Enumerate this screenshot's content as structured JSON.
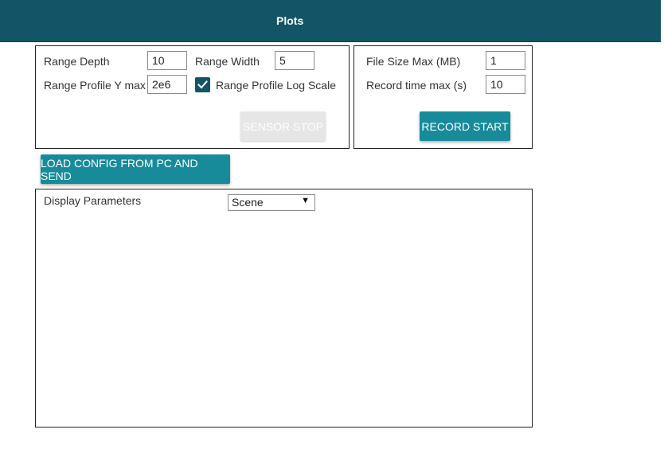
{
  "header": {
    "title": "Plots"
  },
  "sensor_panel": {
    "range_depth_label": "Range Depth",
    "range_depth_value": "10",
    "range_width_label": "Range Width",
    "range_width_value": "5",
    "range_profile_ymax_label": "Range Profile Y max",
    "range_profile_ymax_value": "2e6",
    "log_scale_label": "Range Profile Log Scale",
    "log_scale_checked": true,
    "sensor_stop_label": "SENSOR STOP"
  },
  "record_panel": {
    "file_size_label": "File Size Max (MB)",
    "file_size_value": "1",
    "record_time_label": "Record time max (s)",
    "record_time_value": "10",
    "record_start_label": "RECORD START"
  },
  "load_config_label": "LOAD CONFIG FROM PC AND SEND",
  "display_panel": {
    "label": "Display Parameters",
    "selected": "Scene"
  },
  "colors": {
    "header_bg": "#135566",
    "button_bg": "#178b9a",
    "checkbox_bg": "#135566",
    "disabled_bg": "#e6e6e6"
  }
}
